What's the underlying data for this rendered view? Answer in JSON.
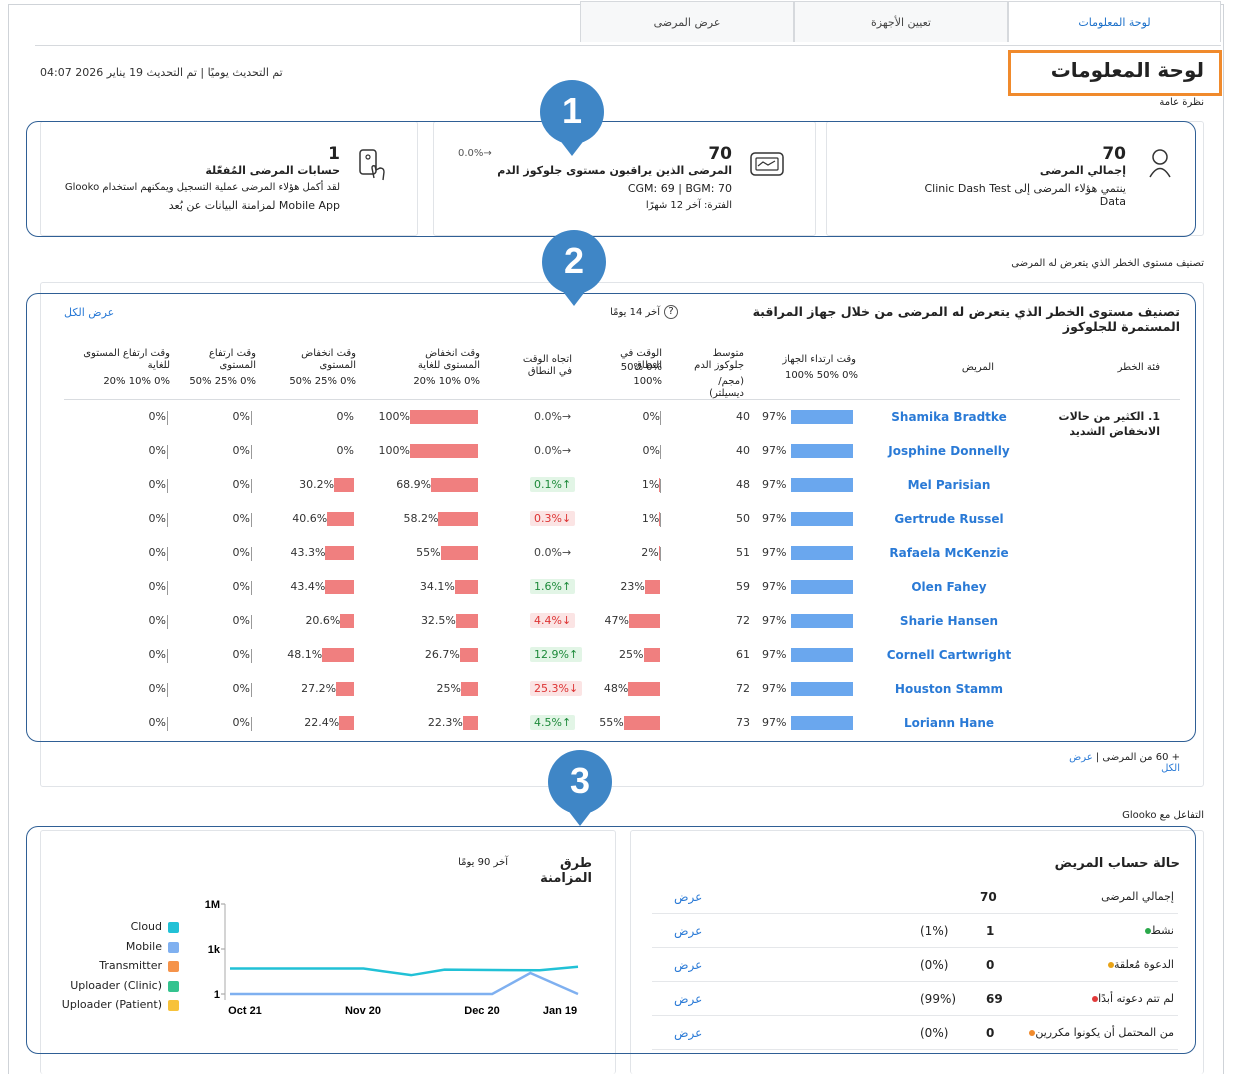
{
  "tabs": [
    {
      "label": "لوحة المعلومات",
      "active": true
    },
    {
      "label": "تعيين الأجهزة",
      "active": false
    },
    {
      "label": "عرض المرضى",
      "active": false
    }
  ],
  "page_title": "لوحة المعلومات",
  "update_info": "تم التحديث يوميًا | تم التحديث  19 يناير 2026 04:07",
  "overview_label": "نظرة عامة",
  "callouts": [
    "1",
    "2",
    "3"
  ],
  "overview_cards": [
    {
      "icon": "person-icon",
      "value": "70",
      "title": "إجمالي المرضى",
      "subtitle": "ينتمي هؤلاء المرضى إلى Clinic Dash Test Data"
    },
    {
      "icon": "monitor-icon",
      "value": "70",
      "title": "المرضى الذين يراقبون مستوى جلوكوز الدم",
      "detail": "CGM: 69 | BGM: 70",
      "period": "الفترة: آخر 12 شهرًا",
      "trend": "0.0%→"
    },
    {
      "icon": "phone-tap-icon",
      "value": "1",
      "title": "حسابات المرضى المُفعّلة",
      "subtitle": "لقد أكمل هؤلاء المرضى عملية التسجيل ويمكنهم استخدام Glooko",
      "subtitle2": "Mobile App لمزامنة البيانات عن بُعد"
    }
  ],
  "risk_section_label": "تصنيف مستوى الخطر الذي يتعرض له المرضى",
  "risk_table": {
    "title": "تصنيف مستوى الخطر الذي يتعرض له المرضى من خلال جهاز المراقبة المستمرة للجلوكوز",
    "period": "آخر 14 يومًا",
    "view_all": "عرض الكل",
    "columns": [
      {
        "label": "فئة الخطر"
      },
      {
        "label": "المريض"
      },
      {
        "label": "وقت ارتداء الجهاز",
        "scale": "100% 50% 0%"
      },
      {
        "label": "متوسط جلوكوز الدم",
        "unit": "(مجم/ديسيلتر)"
      },
      {
        "label": "الوقت في النطاق",
        "scale1": "50% 0%",
        "scale2": "100%"
      },
      {
        "label": "اتجاه الوقت في النطاق"
      },
      {
        "label": "وقت انخفاض المستوى للغاية",
        "scale": "20% 10% 0%"
      },
      {
        "label": "وقت انخفاض المستوى",
        "scale": "50% 25% 0%"
      },
      {
        "label": "وقت ارتفاع المستوى",
        "scale": "50% 25% 0%"
      },
      {
        "label": "وقت ارتفاع المستوى للغاية",
        "scale": "20% 10% 0%"
      }
    ],
    "category": "1. الكثير من حالات الانخفاض الشديد",
    "rows": [
      {
        "name": "Shamika Bradtke",
        "wear": "97%",
        "wear_val": 97,
        "avg": "40",
        "tir": "0%",
        "tir_val": 0,
        "trend": "0.0%→",
        "trend_dir": "flat",
        "vlow": "100%",
        "vlow_val": 100,
        "low": "0%",
        "low_val": 0,
        "high": "0%",
        "vhigh": "0%"
      },
      {
        "name": "Josphine Donnelly",
        "wear": "97%",
        "wear_val": 97,
        "avg": "40",
        "tir": "0%",
        "tir_val": 0,
        "trend": "0.0%→",
        "trend_dir": "flat",
        "vlow": "100%",
        "vlow_val": 100,
        "low": "0%",
        "low_val": 0,
        "high": "0%",
        "vhigh": "0%"
      },
      {
        "name": "Mel Parisian",
        "wear": "97%",
        "wear_val": 97,
        "avg": "48",
        "tir": "1%",
        "tir_val": 1,
        "trend": "0.1%↑",
        "trend_dir": "up",
        "vlow": "68.9%",
        "vlow_val": 68.9,
        "low": "30.2%",
        "low_val": 30.2,
        "high": "0%",
        "vhigh": "0%"
      },
      {
        "name": "Gertrude Russel",
        "wear": "97%",
        "wear_val": 97,
        "avg": "50",
        "tir": "1%",
        "tir_val": 1,
        "trend": "0.3%↓",
        "trend_dir": "down",
        "vlow": "58.2%",
        "vlow_val": 58.2,
        "low": "40.6%",
        "low_val": 40.6,
        "high": "0%",
        "vhigh": "0%"
      },
      {
        "name": "Rafaela McKenzie",
        "wear": "97%",
        "wear_val": 97,
        "avg": "51",
        "tir": "2%",
        "tir_val": 2,
        "trend": "0.0%→",
        "trend_dir": "flat",
        "vlow": "55%",
        "vlow_val": 55,
        "low": "43.3%",
        "low_val": 43.3,
        "high": "0%",
        "vhigh": "0%"
      },
      {
        "name": "Olen Fahey",
        "wear": "97%",
        "wear_val": 97,
        "avg": "59",
        "tir": "23%",
        "tir_val": 23,
        "trend": "1.6%↑",
        "trend_dir": "up",
        "vlow": "34.1%",
        "vlow_val": 34.1,
        "low": "43.4%",
        "low_val": 43.4,
        "high": "0%",
        "vhigh": "0%"
      },
      {
        "name": "Sharie Hansen",
        "wear": "97%",
        "wear_val": 97,
        "avg": "72",
        "tir": "47%",
        "tir_val": 47,
        "trend": "4.4%↓",
        "trend_dir": "down",
        "vlow": "32.5%",
        "vlow_val": 32.5,
        "low": "20.6%",
        "low_val": 20.6,
        "high": "0%",
        "vhigh": "0%"
      },
      {
        "name": "Cornell Cartwright",
        "wear": "97%",
        "wear_val": 97,
        "avg": "61",
        "tir": "25%",
        "tir_val": 25,
        "trend": "12.9%↑",
        "trend_dir": "up",
        "vlow": "26.7%",
        "vlow_val": 26.7,
        "low": "48.1%",
        "low_val": 48.1,
        "high": "0%",
        "vhigh": "0%"
      },
      {
        "name": "Houston Stamm",
        "wear": "97%",
        "wear_val": 97,
        "avg": "72",
        "tir": "48%",
        "tir_val": 48,
        "trend": "25.3%↓",
        "trend_dir": "down",
        "vlow": "25%",
        "vlow_val": 25,
        "low": "27.2%",
        "low_val": 27.2,
        "high": "0%",
        "vhigh": "0%"
      },
      {
        "name": "Loriann Hane",
        "wear": "97%",
        "wear_val": 97,
        "avg": "73",
        "tir": "55%",
        "tir_val": 55,
        "trend": "4.5%↑",
        "trend_dir": "up",
        "vlow": "22.3%",
        "vlow_val": 22.3,
        "low": "22.4%",
        "low_val": 22.4,
        "high": "0%",
        "vhigh": "0%"
      }
    ],
    "more_patients": "+ 60 من المرضى | ",
    "more_link": "عرض الكل"
  },
  "glooko_section_label": "التفاعل مع Glooko",
  "account_status": {
    "title": "حالة حساب المريض",
    "total_label": "إجمالي المرضى",
    "total_value": "70",
    "rows": [
      {
        "label": "نشط",
        "color": "#2aa84a",
        "count": "1",
        "pct": "(1%)",
        "link": "عرض"
      },
      {
        "label": "الدعوة مُعلقة",
        "color": "#e8a317",
        "count": "0",
        "pct": "(0%)",
        "link": "عرض"
      },
      {
        "label": "لم تتم دعوته أبدًا",
        "color": "#e23b3b",
        "count": "69",
        "pct": "(99%)",
        "link": "عرض"
      },
      {
        "label": "من المحتمل أن يكونوا مكررين",
        "color": "#f08a2c",
        "count": "0",
        "pct": "(0%)",
        "link": "عرض"
      }
    ],
    "top_link": "عرض"
  },
  "sync_chart_title": "طرق المزامنة",
  "sync_chart_period": "آخر 90 يومًا",
  "chart_data": {
    "type": "line",
    "title": "طرق المزامنة",
    "x": [
      "Oct 21",
      "Nov 20",
      "Dec 20",
      "Jan 19"
    ],
    "y_ticks": [
      "1M",
      "1k",
      "1"
    ],
    "y_scale": "log",
    "ylim": [
      1,
      1000000
    ],
    "series": [
      {
        "name": "Cloud",
        "color": "#21c1d6",
        "points": [
          [
            0.27,
            50
          ],
          [
            0.35,
            50
          ],
          [
            0.55,
            50
          ],
          [
            0.65,
            18
          ],
          [
            0.72,
            42
          ],
          [
            0.82,
            40
          ],
          [
            0.92,
            38
          ],
          [
            1.0,
            65
          ]
        ]
      },
      {
        "name": "Mobile",
        "color": "#7fb0f0",
        "points": [
          [
            0.27,
            1
          ],
          [
            0.82,
            1
          ],
          [
            0.9,
            25
          ],
          [
            1.0,
            1
          ]
        ]
      },
      {
        "name": "Transmitter",
        "color": "#f5934a",
        "points": []
      },
      {
        "name": "Uploader (Clinic)",
        "color": "#34c38f",
        "points": []
      },
      {
        "name": "Uploader (Patient)",
        "color": "#f7c23a",
        "points": []
      }
    ],
    "legend": "left"
  }
}
